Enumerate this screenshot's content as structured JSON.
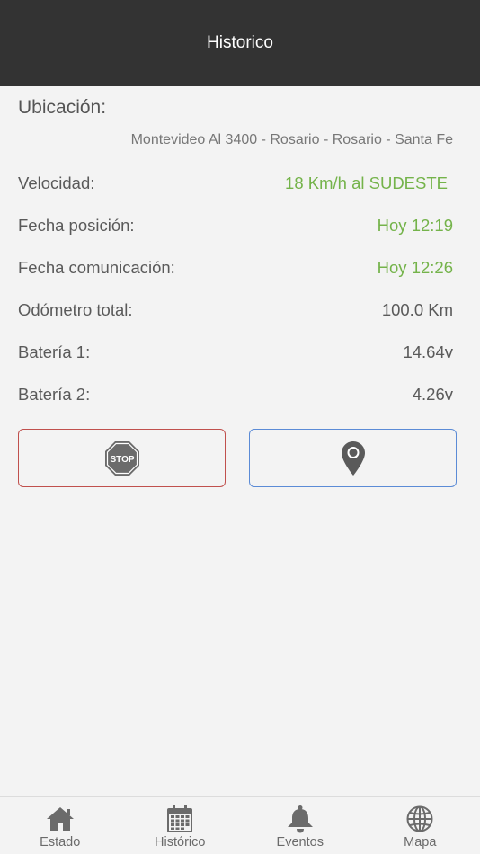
{
  "header": {
    "title": "Historico"
  },
  "details": {
    "section_title": "Ubicación:",
    "address": "Montevideo Al 3400 - Rosario - Rosario - Santa Fe",
    "rows": [
      {
        "label": "Velocidad:",
        "value": "18 Km/h al SUDESTE",
        "highlight": true
      },
      {
        "label": "Fecha posición:",
        "value": "Hoy 12:19",
        "highlight": true
      },
      {
        "label": "Fecha comunicación:",
        "value": "Hoy 12:26",
        "highlight": true
      },
      {
        "label": "Odómetro total:",
        "value": "100.0 Km",
        "highlight": false
      },
      {
        "label": "Batería 1:",
        "value": "14.64v",
        "highlight": false
      },
      {
        "label": "Batería 2:",
        "value": "4.26v",
        "highlight": false
      }
    ]
  },
  "actions": {
    "stop_label": "STOP",
    "stop_icon": "stop-sign-icon",
    "locate_icon": "map-pin-icon"
  },
  "nav": {
    "items": [
      {
        "label": "Estado",
        "icon": "home-icon"
      },
      {
        "label": "Histórico",
        "icon": "calendar-icon"
      },
      {
        "label": "Eventos",
        "icon": "bell-icon"
      },
      {
        "label": "Mapa",
        "icon": "globe-icon"
      }
    ]
  },
  "colors": {
    "app_bar": "#333333",
    "highlight_value": "#74b34a",
    "stop_border": "#c0504d",
    "locate_border": "#5b8bd6",
    "icon_gray": "#6b6b6b"
  }
}
